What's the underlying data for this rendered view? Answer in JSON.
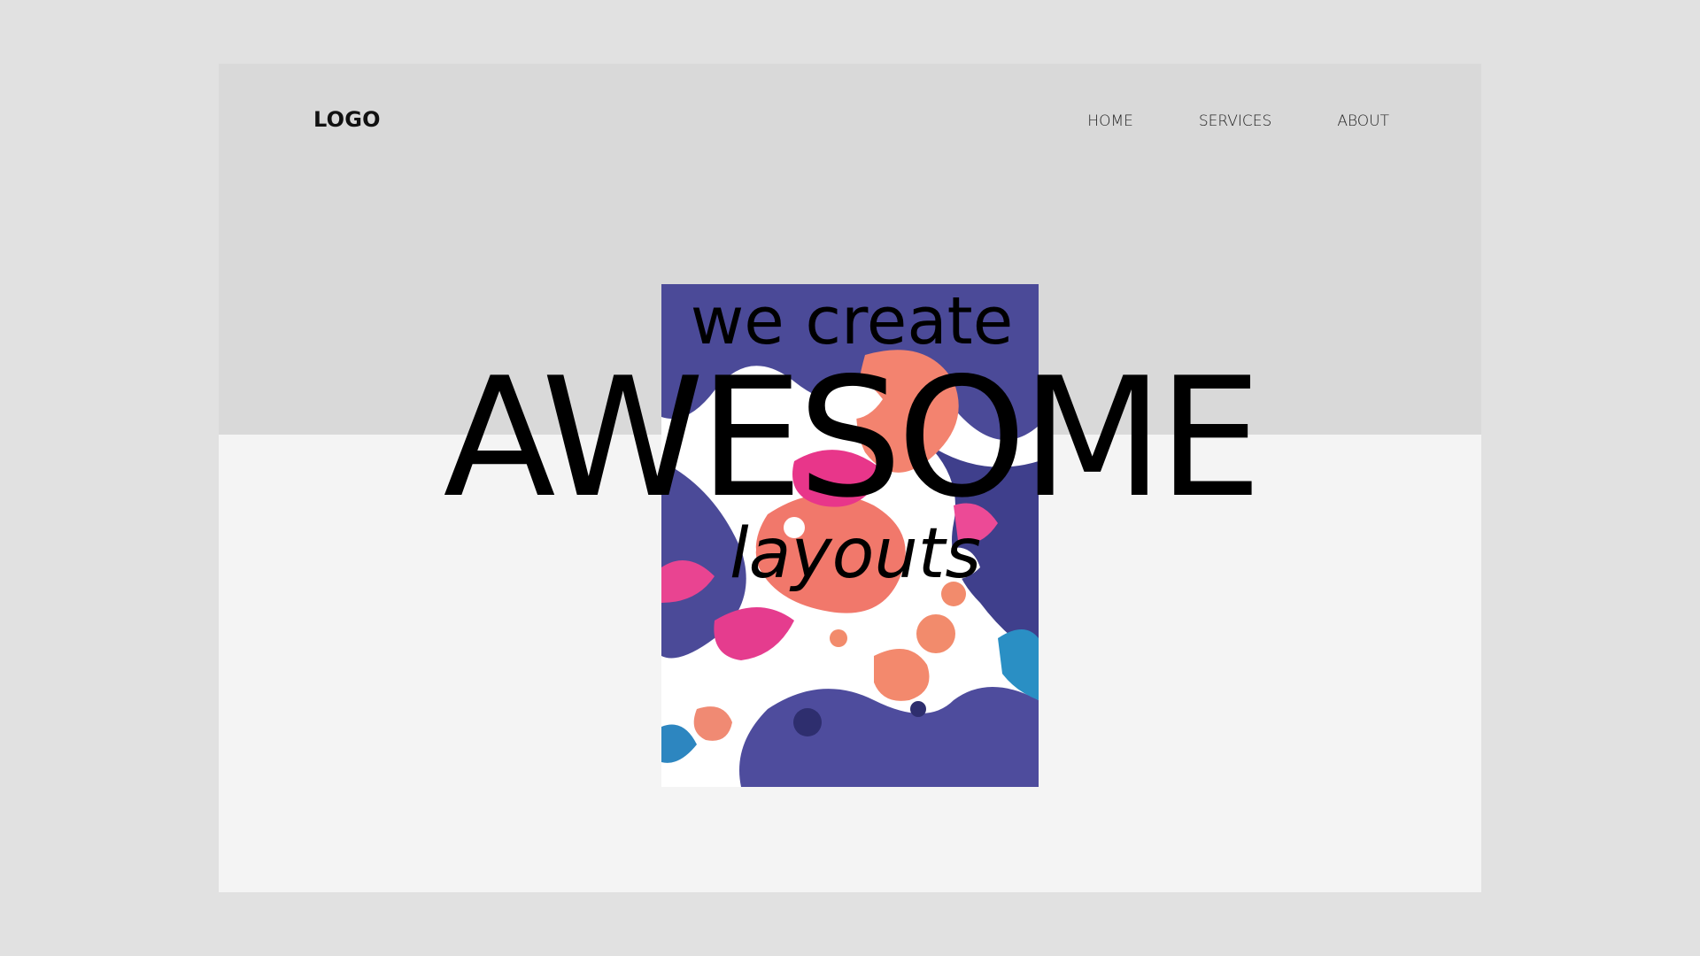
{
  "header": {
    "logo": "LOGO",
    "nav": [
      {
        "label": "HOME"
      },
      {
        "label": "SERVICES"
      },
      {
        "label": "ABOUT"
      }
    ]
  },
  "hero": {
    "line1": "we create",
    "line2": "AWESOME",
    "line3": "layouts"
  },
  "colors": {
    "page_background": "#e1e1e1",
    "header_band": "#d9d9d9",
    "content_background": "#f4f4f4",
    "text": "#000000",
    "art_palette": [
      "#4a4a9a",
      "#f27d72",
      "#e8388c",
      "#ffffff",
      "#2a8fc4"
    ]
  }
}
